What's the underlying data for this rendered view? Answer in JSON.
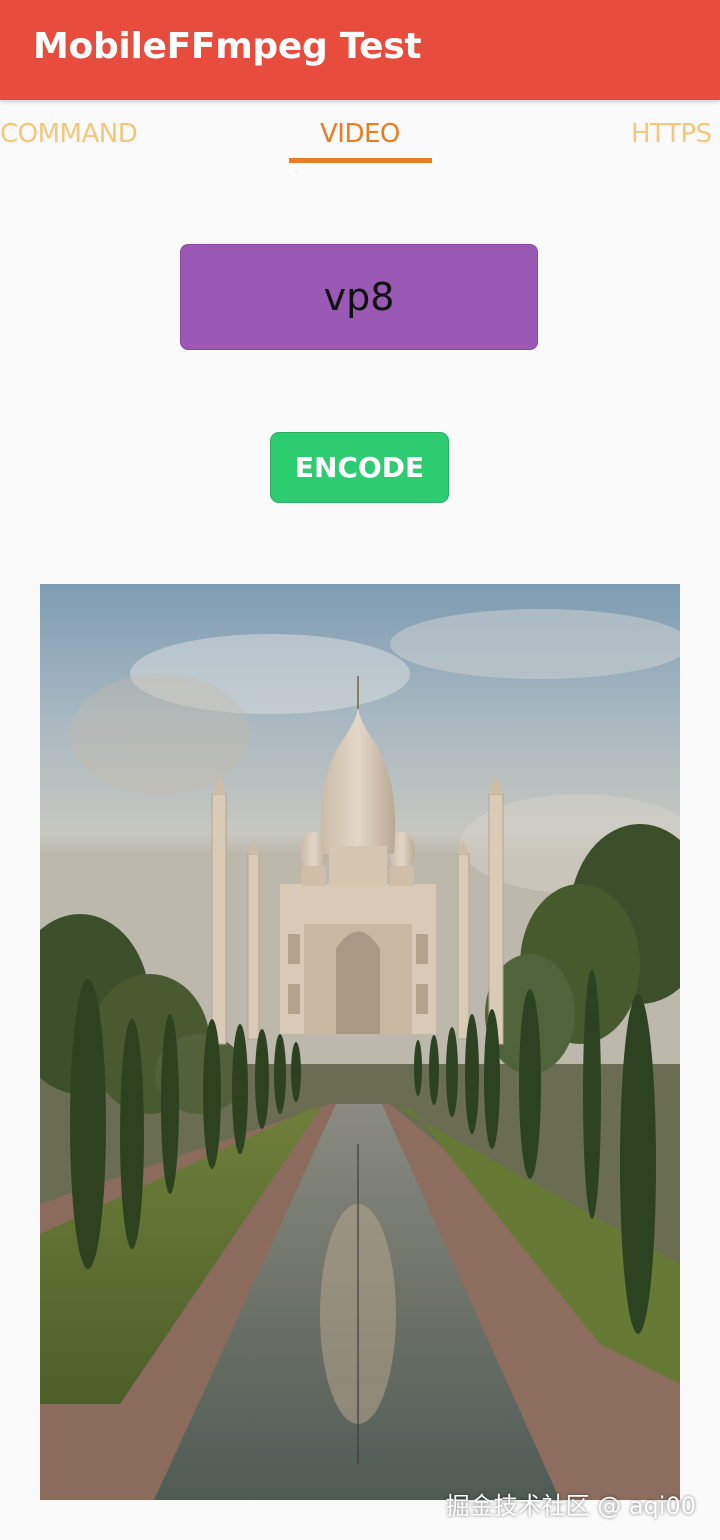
{
  "appbar": {
    "title": "MobileFFmpeg Test"
  },
  "tabs": [
    {
      "label": "COMMAND",
      "active": false
    },
    {
      "label": "VIDEO",
      "active": true
    },
    {
      "label": "HTTPS",
      "active": false
    }
  ],
  "codec": {
    "selected": "vp8"
  },
  "encode_button": {
    "label": "ENCODE"
  },
  "watermark": "掘金技术社区 @ aqi00",
  "colors": {
    "appbar": "#e74c3c",
    "tab_active": "#e67e22",
    "tab_inactive": "#f3c77c",
    "codec_select": "#9b59b6",
    "encode_button": "#2ecc71"
  }
}
